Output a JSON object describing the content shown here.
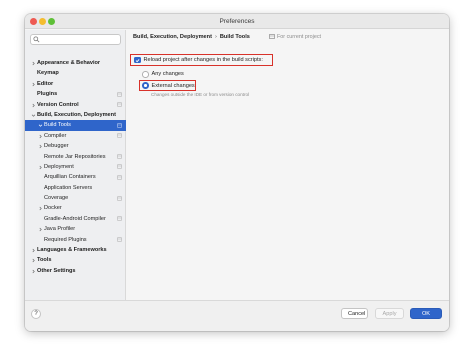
{
  "window": {
    "title": "Preferences"
  },
  "search": {
    "placeholder": "",
    "value": ""
  },
  "sidebar": {
    "items": [
      {
        "label": "Appearance & Behavior",
        "bold": true,
        "level": 0,
        "chevron": "right"
      },
      {
        "label": "Keymap",
        "bold": true,
        "level": 0,
        "chevron": "none"
      },
      {
        "label": "Editor",
        "bold": true,
        "level": 0,
        "chevron": "right"
      },
      {
        "label": "Plugins",
        "bold": true,
        "level": 0,
        "chevron": "none",
        "cfg": true
      },
      {
        "label": "Version Control",
        "bold": true,
        "level": 0,
        "chevron": "right",
        "cfg": true
      },
      {
        "label": "Build, Execution, Deployment",
        "bold": true,
        "level": 0,
        "chevron": "down"
      },
      {
        "label": "Build Tools",
        "bold": false,
        "level": 1,
        "chevron": "down",
        "cfg": true,
        "selected": true
      },
      {
        "label": "Compiler",
        "bold": false,
        "level": 1,
        "chevron": "right",
        "cfg": true
      },
      {
        "label": "Debugger",
        "bold": false,
        "level": 1,
        "chevron": "right"
      },
      {
        "label": "Remote Jar Repositories",
        "bold": false,
        "level": 1,
        "chevron": "none",
        "cfg": true
      },
      {
        "label": "Deployment",
        "bold": false,
        "level": 1,
        "chevron": "right",
        "cfg": true
      },
      {
        "label": "Arquillian Containers",
        "bold": false,
        "level": 1,
        "chevron": "none",
        "cfg": true
      },
      {
        "label": "Application Servers",
        "bold": false,
        "level": 1,
        "chevron": "none"
      },
      {
        "label": "Coverage",
        "bold": false,
        "level": 1,
        "chevron": "none",
        "cfg": true
      },
      {
        "label": "Docker",
        "bold": false,
        "level": 1,
        "chevron": "right"
      },
      {
        "label": "Gradle-Android Compiler",
        "bold": false,
        "level": 1,
        "chevron": "none",
        "cfg": true
      },
      {
        "label": "Java Profiler",
        "bold": false,
        "level": 1,
        "chevron": "right"
      },
      {
        "label": "Required Plugins",
        "bold": false,
        "level": 1,
        "chevron": "none",
        "cfg": true
      },
      {
        "label": "Languages & Frameworks",
        "bold": true,
        "level": 0,
        "chevron": "right"
      },
      {
        "label": "Tools",
        "bold": true,
        "level": 0,
        "chevron": "right"
      },
      {
        "label": "Other Settings",
        "bold": true,
        "level": 0,
        "chevron": "right"
      }
    ]
  },
  "content": {
    "breadcrumb": [
      "Build, Execution, Deployment",
      "Build Tools"
    ],
    "breadcrumb_separator": "›",
    "scope_label": "For current project",
    "reload_checkbox": {
      "label": "Reload project after changes in the build scripts:",
      "checked": true
    },
    "radio_any": {
      "label": "Any changes",
      "selected": false
    },
    "radio_external": {
      "label": "External changes",
      "selected": true
    },
    "external_hint": "Changes outside the IDE or from version control"
  },
  "footer": {
    "help_label": "?",
    "cancel_label": "Cancel",
    "apply_label": "Apply",
    "ok_label": "OK"
  },
  "colors": {
    "accent": "#2f65ca",
    "highlight_border": "#d8322a",
    "sidebar_bg": "#eeeff1",
    "content_bg": "#f5f5f5"
  }
}
